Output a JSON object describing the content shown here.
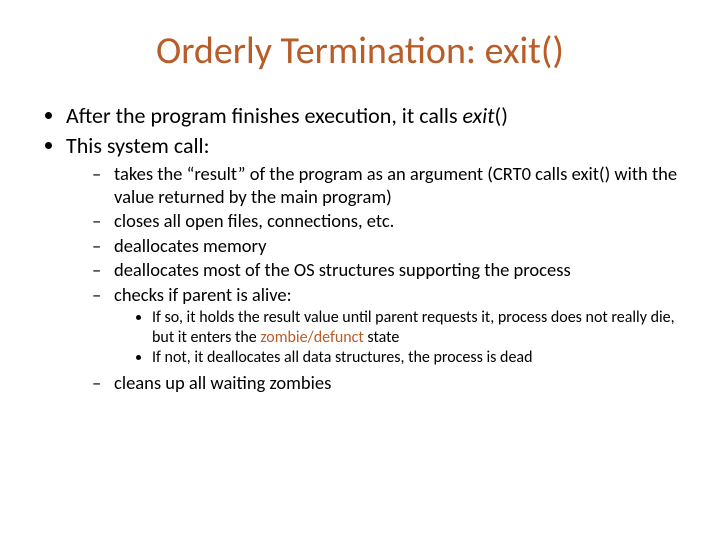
{
  "title": "Orderly Termination: exit()",
  "bullets": {
    "b1_pre": "After the program finishes execution, it calls ",
    "b1_em": "exit",
    "b1_post": "()",
    "b2": "This system call:",
    "sub": {
      "s1": "takes the “result” of the program as an argument (CRT0 calls exit() with the value returned by the main program)",
      "s2": "closes all open files, connections, etc.",
      "s3": "deallocates memory",
      "s4": "deallocates most of the OS structures supporting the process",
      "s5": "checks if parent is alive:",
      "s6": "cleans up all waiting zombies"
    },
    "subsub": {
      "ss1_pre": "If so, it holds the result value until parent requests it, process does not really die, but it enters the ",
      "ss1_em": "zombie/defunct",
      "ss1_post": " state",
      "ss2": "If not, it deallocates all data structures, the process is dead"
    }
  }
}
